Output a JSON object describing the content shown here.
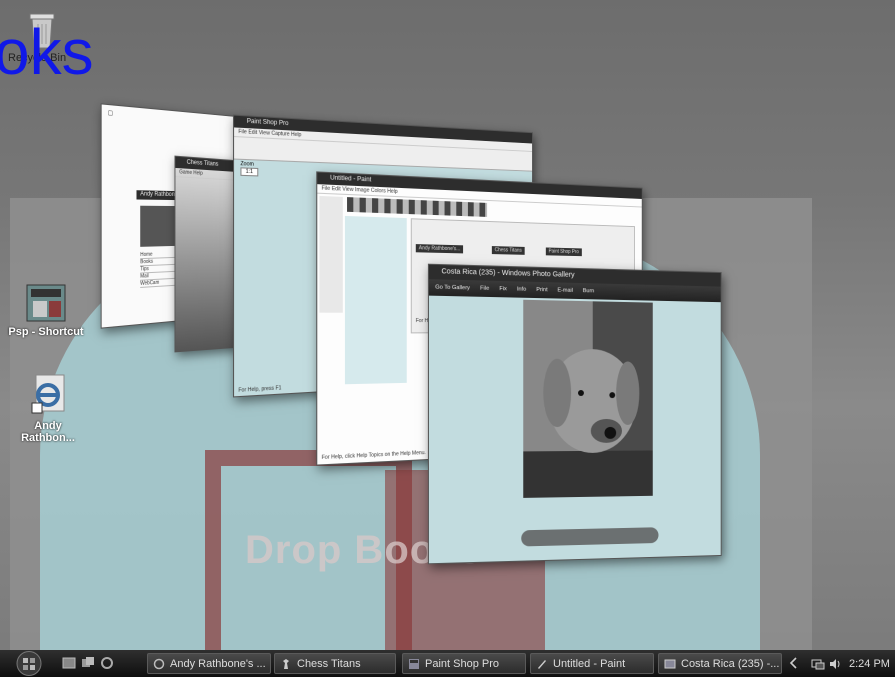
{
  "overlay_text": "oks",
  "desktop_icons": {
    "recycle_bin": "Recycle Bin",
    "psp_shortcut": "Psp - Shortcut",
    "andy": "Andy Rathbon..."
  },
  "wallpaper_text": "Drop Books",
  "windows": {
    "ie": {
      "title": "Andy Rathbone's ...",
      "sidebar_items": [
        "Home",
        "Books",
        "Tips",
        "Mail",
        "WebCam"
      ]
    },
    "chess": {
      "title": "Chess Titans",
      "menu": "Game   Help"
    },
    "psp": {
      "title": "Paint Shop Pro",
      "menu": "File   Edit   View   Capture   Help",
      "zoom_label": "Zoom",
      "zoom_value": "1:1",
      "status": "For Help, press F1"
    },
    "paint": {
      "title": "Untitled - Paint",
      "menu": "File   Edit   View   Image   Colors   Help",
      "status": "For Help, click Help Topics on the Help Menu.",
      "inner_tasks": [
        "Andy Rathbone's...",
        "Chess Titans",
        "Paint Shop Pro"
      ],
      "inner_status": "For Help, press F1"
    },
    "photo": {
      "title": "Costa Rica (235) - Windows Photo Gallery",
      "toolbar": [
        "Go To Gallery",
        "File",
        "Fix",
        "Info",
        "Print",
        "E-mail",
        "Burn"
      ]
    }
  },
  "taskbar": {
    "buttons": [
      "Andy Rathbone's ...",
      "Chess Titans",
      "Paint Shop Pro",
      "Untitled - Paint",
      "Costa Rica (235) -..."
    ],
    "clock": "2:24 PM"
  }
}
